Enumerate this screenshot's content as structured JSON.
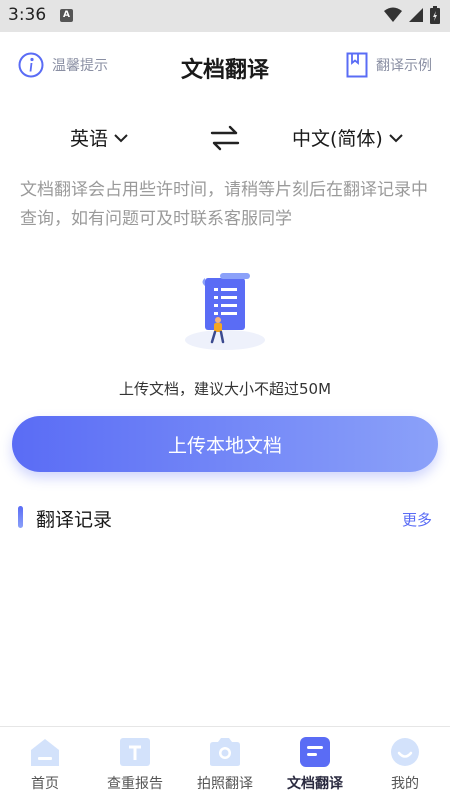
{
  "status_bar": {
    "time": "3:36",
    "notification_letter": "A"
  },
  "header": {
    "tip_label": "温馨提示",
    "title": "文档翻译",
    "example_label": "翻译示例"
  },
  "languages": {
    "source": "英语",
    "target": "中文(简体)"
  },
  "description": "文档翻译会占用些许时间，请稍等片刻后在翻译记录中查询，如有问题可及时联系客服同学",
  "upload": {
    "hint": "上传文档，建议大小不超过50M",
    "button_label": "上传本地文档"
  },
  "records": {
    "title": "翻译记录",
    "more_label": "更多"
  },
  "bottom_nav": {
    "items": [
      {
        "label": "首页",
        "icon": "home-icon"
      },
      {
        "label": "查重报告",
        "icon": "report-icon"
      },
      {
        "label": "拍照翻译",
        "icon": "camera-icon"
      },
      {
        "label": "文档翻译",
        "icon": "document-icon",
        "active": true
      },
      {
        "label": "我的",
        "icon": "profile-icon"
      }
    ]
  },
  "colors": {
    "accent": "#5a6cf5",
    "accent_light": "#8ba1f9",
    "muted_text": "#9a9a9a",
    "icon_inactive": "#d3e2fb",
    "icon_active": "#5a6cf5"
  }
}
